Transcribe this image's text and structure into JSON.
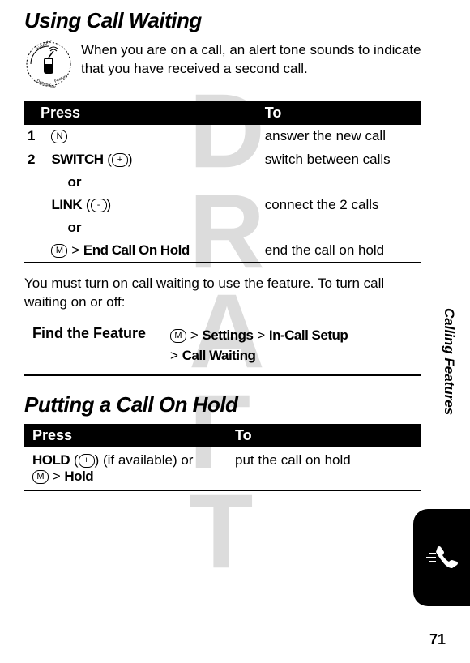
{
  "watermark": "DRAFT",
  "section1_title": "Using Call Waiting",
  "intro_text": "When you are on a call, an alert tone sounds to indicate that you have received a second call.",
  "table1": {
    "headers": {
      "press": "Press",
      "to": "To"
    },
    "row1": {
      "num": "1",
      "key": "N",
      "action": "answer the new call"
    },
    "row2": {
      "num": "2",
      "switch_label": "SWITCH",
      "switch_key": "+",
      "switch_action": "switch between calls",
      "or1": "or",
      "link_label": "LINK",
      "link_key": "-",
      "link_action": "connect the 2 calls",
      "or2": "or",
      "menu_key": "M",
      "end_label": "End Call On Hold",
      "end_action": "end the call on hold"
    }
  },
  "paragraph1": "You must turn on call waiting to use the feature. To turn call waiting on or off:",
  "find_feature_label": "Find the Feature",
  "find_feature_key": "M",
  "find_feature_path1a": "Settings",
  "find_feature_path1b": "In-Call Setup",
  "find_feature_path2": "Call Waiting",
  "section2_title": "Putting a Call On Hold",
  "table2": {
    "headers": {
      "press": "Press",
      "to": "To"
    },
    "row1": {
      "hold_label": "HOLD",
      "hold_key": "+",
      "avail_text": " (if available) or ",
      "menu_key": "M",
      "hold_path": "Hold",
      "action": "put the call on hold"
    }
  },
  "side_label": "Calling Features",
  "page_number": "71"
}
